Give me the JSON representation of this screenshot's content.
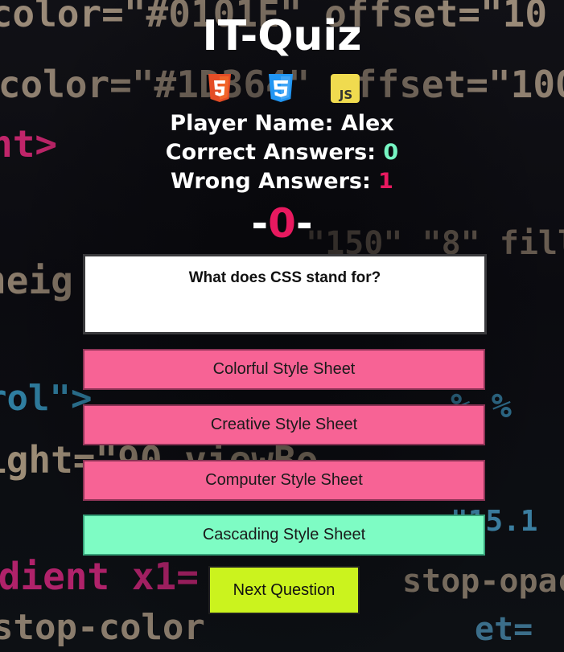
{
  "app": {
    "title": "IT-Quiz",
    "icons": [
      "html5-icon",
      "css3-icon",
      "javascript-icon"
    ]
  },
  "stats": {
    "player_label": "Player Name: ",
    "player_name": "Alex",
    "correct_label": "Correct Answers: ",
    "correct_count": "0",
    "wrong_label": "Wrong Answers: ",
    "wrong_count": "1"
  },
  "score": {
    "prefix": "-",
    "value": "0",
    "suffix": "-"
  },
  "question": {
    "text": "What does CSS stand for?"
  },
  "answers": [
    {
      "label": "Colorful Style Sheet",
      "state": "wrong"
    },
    {
      "label": "Creative Style Sheet",
      "state": "wrong"
    },
    {
      "label": "Computer Style Sheet",
      "state": "wrong"
    },
    {
      "label": "Cascading Style Sheet",
      "state": "correct"
    }
  ],
  "next_button": {
    "label": "Next Question"
  },
  "colors": {
    "wrong_answer": "#f76395",
    "correct_answer": "#7efcc4",
    "next_button": "#cbf31e",
    "accent_pink": "#e8195f",
    "accent_green": "#76f5c2"
  }
}
